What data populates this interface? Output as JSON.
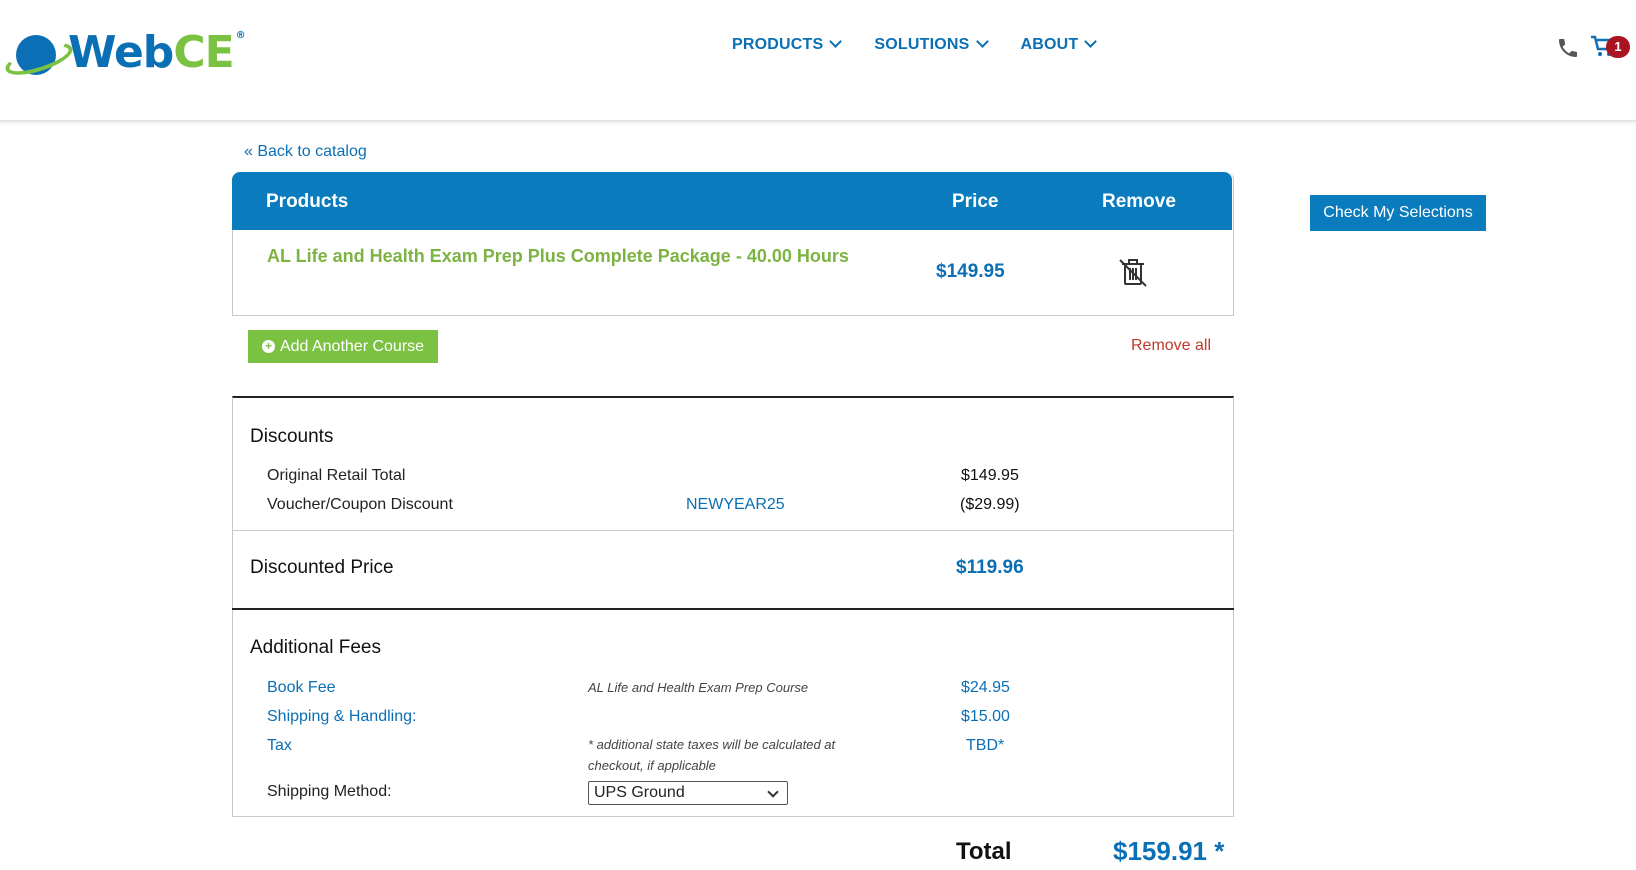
{
  "header": {
    "logo": {
      "web": "Web",
      "ce": "CE",
      "reg": "®"
    },
    "nav": [
      {
        "label": "PRODUCTS"
      },
      {
        "label": "SOLUTIONS"
      },
      {
        "label": "ABOUT"
      }
    ],
    "cart_count": "1"
  },
  "back_link": "« Back to catalog",
  "cart": {
    "headers": {
      "products": "Products",
      "price": "Price",
      "remove": "Remove"
    },
    "items": [
      {
        "name": "AL Life and Health Exam Prep Plus Complete Package - 40.00 Hours",
        "price": "$149.95"
      }
    ],
    "add_button": "Add Another Course",
    "remove_all": "Remove all"
  },
  "check_button": "Check My Selections",
  "discounts": {
    "title": "Discounts",
    "original_label": "Original Retail Total",
    "original_value": "$149.95",
    "coupon_label": "Voucher/Coupon Discount",
    "coupon_code": "NEWYEAR25",
    "coupon_value": "($29.99)"
  },
  "discounted": {
    "label": "Discounted Price",
    "value": "$119.96"
  },
  "fees": {
    "title": "Additional Fees",
    "book_label": "Book Fee",
    "book_note": "AL Life and Health Exam Prep Course",
    "book_value": "$24.95",
    "shipping_label": "Shipping & Handling:",
    "shipping_value": "$15.00",
    "tax_label": "Tax",
    "tax_note_1": "* additional state taxes will be calculated at",
    "tax_note_2": "checkout, if applicable",
    "tax_value": "TBD*",
    "method_label": "Shipping Method:",
    "method_selected": "UPS Ground"
  },
  "total": {
    "label": "Total",
    "value": "$159.91 *"
  },
  "colors": {
    "brand_blue": "#0a7bbd",
    "brand_green": "#7cc242",
    "alert_red": "#c0392b"
  }
}
